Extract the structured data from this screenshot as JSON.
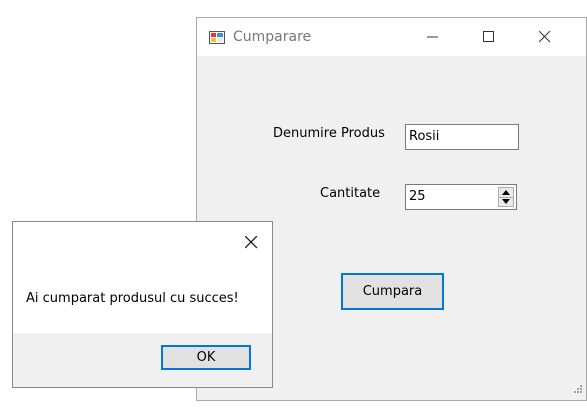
{
  "main_window": {
    "title": "Cumparare",
    "form": {
      "product_name_label": "Denumire Produs",
      "product_name_value": "Rosii",
      "quantity_label": "Cantitate",
      "quantity_value": "25",
      "buy_button_label": "Cumpara"
    }
  },
  "message_box": {
    "text": "Ai cumparat produsul cu succes!",
    "ok_label": "OK"
  },
  "colors": {
    "accent": "#0078d7",
    "window_bg": "#f0f0f0"
  },
  "icons": [
    "app-icon",
    "minimize-icon",
    "maximize-icon",
    "close-icon",
    "spin-up-icon",
    "spin-down-icon",
    "resize-grip-icon"
  ]
}
